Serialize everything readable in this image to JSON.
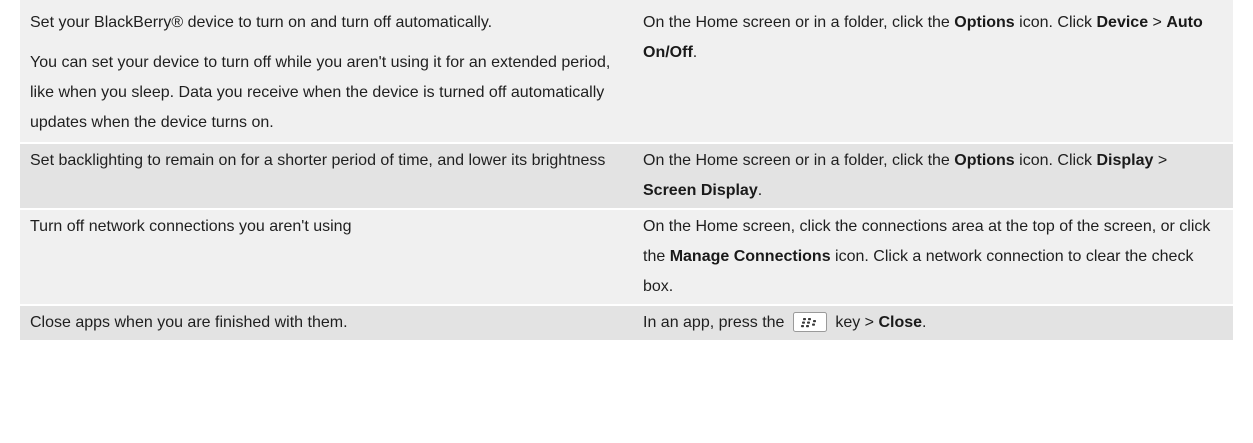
{
  "rows": [
    {
      "tip_p1": "Set your BlackBerry® device to turn on and turn off automatically.",
      "tip_p2": "You can set your device to turn off while you aren't using it for an extended period, like when you sleep. Data you receive when the device is turned off automatically updates when the device turns on.",
      "how": {
        "t1": "On the Home screen or in a folder, click the ",
        "b1": "Options",
        "t2": " icon. Click ",
        "b2": "Device",
        "t3": " > ",
        "b3": "Auto On/Off",
        "t4": "."
      }
    },
    {
      "tip": "Set backlighting to remain on for a shorter period of time, and lower its brightness",
      "how": {
        "t1": "On the Home screen or in a folder, click the ",
        "b1": "Options",
        "t2": " icon. Click ",
        "b2": "Display",
        "t3": " > ",
        "b3": "Screen Display",
        "t4": "."
      }
    },
    {
      "tip": "Turn off network connections you aren't using",
      "how": {
        "t1": "On the Home screen, click the connections area at the top of the screen, or click the ",
        "b1": "Manage Connections",
        "t2": " icon. Click a network connection to clear the check box."
      }
    },
    {
      "tip": "Close apps when you are finished with them.",
      "how": {
        "t1": "In an app, press the ",
        "icon": "blackberry-menu-key-icon",
        "t2": " key > ",
        "b1": "Close",
        "t3": "."
      }
    }
  ],
  "colors": {
    "row_light": "#f0f0f0",
    "row_dark": "#e3e3e3",
    "text": "#1f1f1f"
  }
}
